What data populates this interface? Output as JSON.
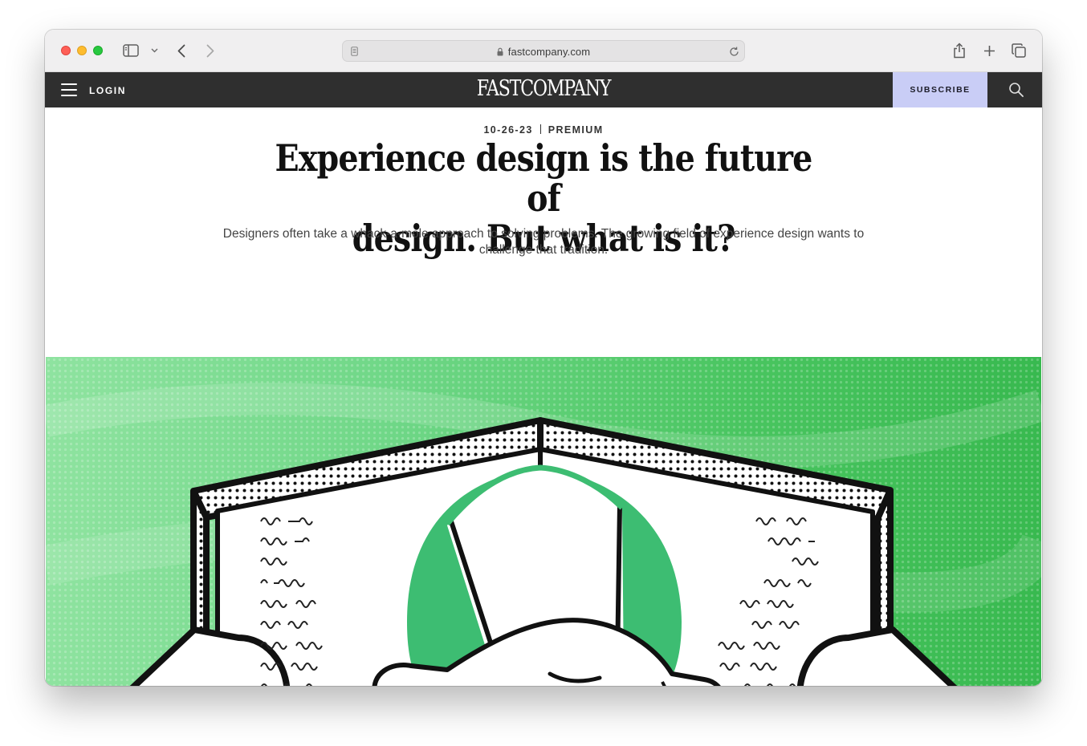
{
  "browser": {
    "url_domain": "fastcompany.com",
    "icons": [
      "sidebar-icon",
      "chevron-down-icon",
      "back-arrow-icon",
      "forward-arrow-icon",
      "reader-icon",
      "lock-icon",
      "reload-icon",
      "share-icon",
      "new-tab-plus-icon",
      "tabs-overview-icon"
    ]
  },
  "site_nav": {
    "login_label": "LOGIN",
    "logo_text": "FASTCOMPANY",
    "subscribe_label": "SUBSCRIBE",
    "subscribe_color": "#c9cdf6",
    "bar_color": "#2f2f2f"
  },
  "article": {
    "date": "10-26-23",
    "category": "PREMIUM",
    "headline_line1": "Experience design is the future of",
    "headline_line2": "design. But what is it?",
    "dek": "Designers often take a whack-a-mole approach to solving problems. The growing field of experience design wants to challenge that tradition.",
    "hero_colors": {
      "green": "#34b84d",
      "light_green": "#9be6a8",
      "accent_green": "#3dbd72"
    }
  }
}
